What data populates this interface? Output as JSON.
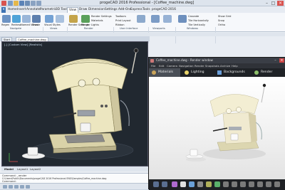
{
  "cad": {
    "title": "progeCAD 2016 Professional - [Coffee_machine.dwg]",
    "menu_tabs": [
      "Home",
      "Insert",
      "Annotate",
      "Parametric",
      "3D Tools",
      "View",
      "Draw",
      "Dimension",
      "Settings",
      "Add-Ons",
      "Express",
      "Tools",
      "progeCAD 2016"
    ],
    "active_menu": "View",
    "ribbon": {
      "buttons": [
        "Regen",
        "Redraw",
        "Named Views",
        "Shade",
        "Visual Styles",
        "Render Settings",
        "Render",
        "Save Render",
        "Toolbars",
        "Ribbon",
        "Properties",
        "Command Line",
        "Layers",
        "Cascade",
        "Tile",
        "Arrange"
      ],
      "checkboxes": [
        "Show Grid",
        "Snap",
        "Ortho"
      ],
      "groups": [
        "Navigate",
        "Views",
        "Render",
        "User Interface",
        "Viewports",
        "Windows"
      ],
      "small_items": [
        "Render Settings",
        "Materials",
        "Lights",
        "Print Layout",
        "Cascade",
        "Tile Horizontally",
        "Tile Vertically"
      ]
    },
    "doc_tabs": [
      "Start",
      "Coffee_machine.dwg"
    ],
    "viewport_label": "[-] [Custom View] [Realistic]",
    "layout_tabs": [
      "Model",
      "Layout1",
      "Layout2"
    ],
    "command_lines": [
      "Command: _render",
      "C:\\Users\\Public\\Documents\\progeCAD 2016 Professional ENG\\Samples\\Coffee_machine.dwg"
    ],
    "command_prompt": "Command:"
  },
  "render": {
    "title": "Coffee_machine.dwg - Render window",
    "menu": [
      "File",
      "Edit",
      "Camera",
      "Navigation",
      "Render",
      "Snapshots",
      "Archive",
      "Help"
    ],
    "tabs": [
      "Materials",
      "Lighting",
      "Backgrounds",
      "Render"
    ],
    "active_tab": "Materials"
  },
  "colors": {
    "viewport_bg": "#212830",
    "machine_cream": "#ece6c0",
    "render_chrome": "#2a2d33"
  }
}
